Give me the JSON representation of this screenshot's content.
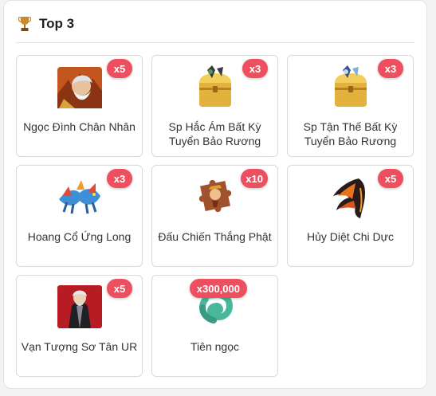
{
  "header": {
    "title": "Top 3",
    "icon": "trophy-icon"
  },
  "colors": {
    "badge": "#ee4f5f",
    "card_border": "#dadada"
  },
  "items": [
    {
      "name": "Ngọc Đình Chân Nhân",
      "qty": "x5",
      "icon": "warrior-portrait-icon"
    },
    {
      "name": "Sp Hắc Ám Bất Kỳ Tuyển Bảo Rương",
      "qty": "x3",
      "icon": "treasure-chest-icon"
    },
    {
      "name": "Sp Tận Thế Bất Kỳ Tuyển Bảo Rương",
      "qty": "x3",
      "icon": "treasure-chest-icon"
    },
    {
      "name": "Hoang Cổ Ứng Long",
      "qty": "x3",
      "icon": "dragon-mount-icon"
    },
    {
      "name": "Đấu Chiến Thắng Phật",
      "qty": "x10",
      "icon": "puzzle-piece-icon"
    },
    {
      "name": "Hủy Diệt Chi Dực",
      "qty": "x5",
      "icon": "dark-wings-icon"
    },
    {
      "name": "Vạn Tượng Sơ Tân UR",
      "qty": "x5",
      "icon": "sage-portrait-icon"
    },
    {
      "name": "Tiên ngọc",
      "qty": "x300,000",
      "icon": "jade-gem-icon"
    }
  ]
}
